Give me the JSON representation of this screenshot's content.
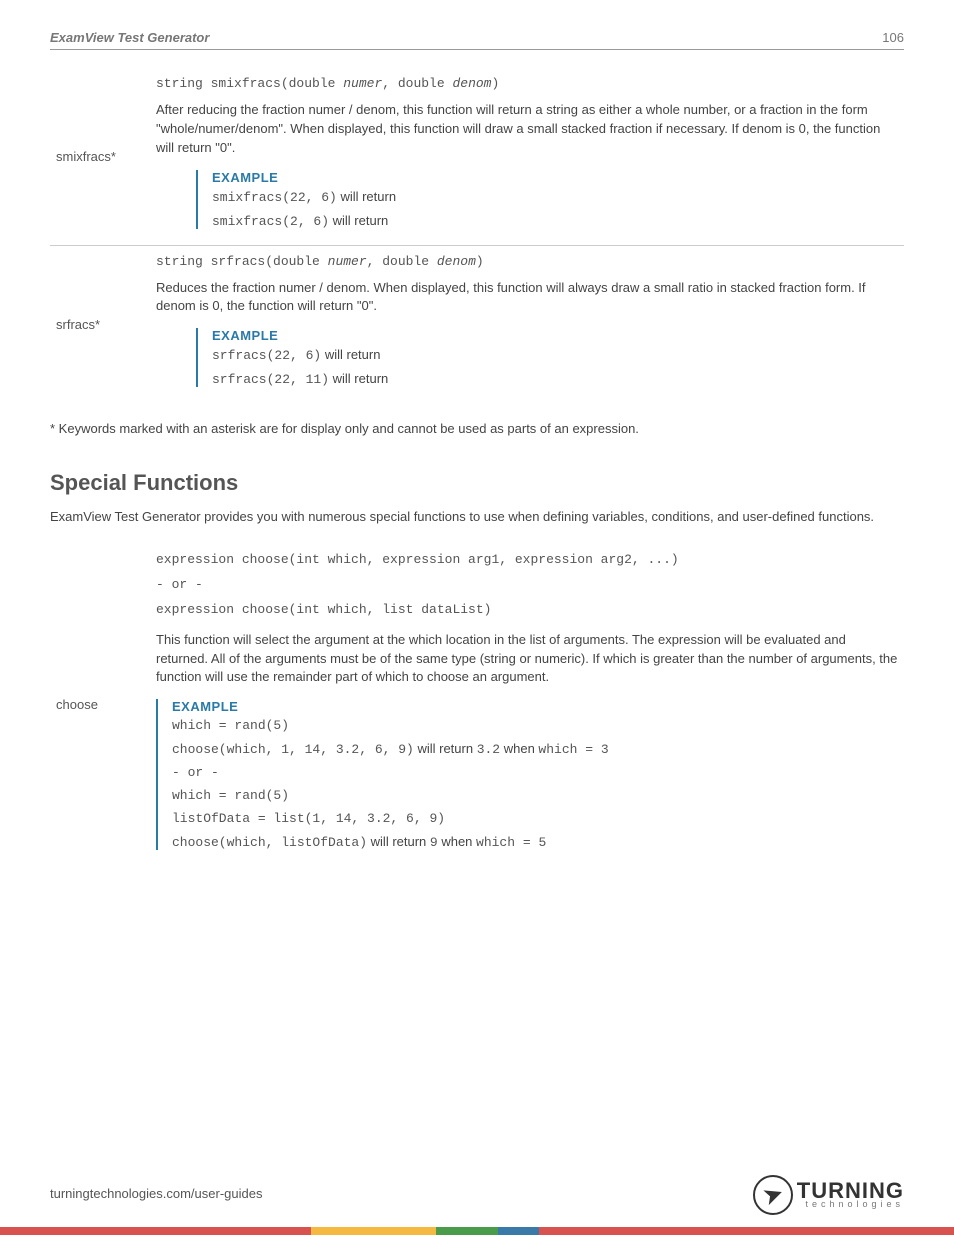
{
  "header": {
    "title": "ExamView Test Generator",
    "page": "106"
  },
  "rows": {
    "smixfracs": {
      "label": "smixfracs*",
      "sig_prefix": "string smixfracs(double ",
      "sig_arg1": "numer",
      "sig_mid": ", double ",
      "sig_arg2": "denom",
      "sig_suffix": ")",
      "desc": "After reducing the fraction numer / denom, this function will return a string as either a whole number, or a fraction in the form \"whole/numer/denom\". When displayed, this function will draw a small stacked fraction if necessary. If denom is 0, the function will return \"0\".",
      "example_label": "EXAMPLE",
      "ex1_code": "smixfracs(22, 6)",
      "ex1_text": " will return",
      "ex2_code": "smixfracs(2, 6)",
      "ex2_text": " will return"
    },
    "srfracs": {
      "label": "srfracs*",
      "sig_prefix": "string srfracs(double ",
      "sig_arg1": "numer",
      "sig_mid": ", double ",
      "sig_arg2": "denom",
      "sig_suffix": ")",
      "desc": "Reduces the fraction numer / denom. When displayed, this function will always draw a small ratio in stacked fraction form. If denom is 0, the function will return \"0\".",
      "example_label": "EXAMPLE",
      "ex1_code": "srfracs(22, 6)",
      "ex1_text": " will return",
      "ex2_code": "srfracs(22, 11)",
      "ex2_text": " will return"
    },
    "choose": {
      "label": "choose",
      "sig1": "expression choose(int which, expression arg1, expression arg2, ...)",
      "sig_or": "- or -",
      "sig2": "expression choose(int which, list dataList)",
      "desc": "This function will select the argument at the which location in the list of arguments. The expression will be evaluated and returned. All of the arguments must be of the same type (string or numeric). If which is greater than the number of arguments, the function will use the remainder part of which to choose an argument.",
      "example_label": "EXAMPLE",
      "l1": "which = rand(5)",
      "l2a": "choose(which, 1, 14, 3.2, 6, 9)",
      "l2b": " will return ",
      "l2c": "3.2",
      "l2d": " when ",
      "l2e": "which = 3",
      "l3": "- or -",
      "l4": "which = rand(5)",
      "l5": "listOfData = list(1, 14, 3.2, 6, 9)",
      "l6a": "choose(which, listOfData)",
      "l6b": " will return ",
      "l6c": "9",
      "l6d": " when ",
      "l6e": "which = 5"
    }
  },
  "footnote": "* Keywords marked with an asterisk are for display only and cannot be used as parts of an expression.",
  "section": {
    "title": "Special Functions",
    "intro": "ExamView Test Generator provides you with numerous special functions to use when defining variables, conditions, and user-defined functions."
  },
  "footer": {
    "url": "turningtechnologies.com/user-guides",
    "logo_main": "TURNING",
    "logo_sub": "technologies"
  }
}
